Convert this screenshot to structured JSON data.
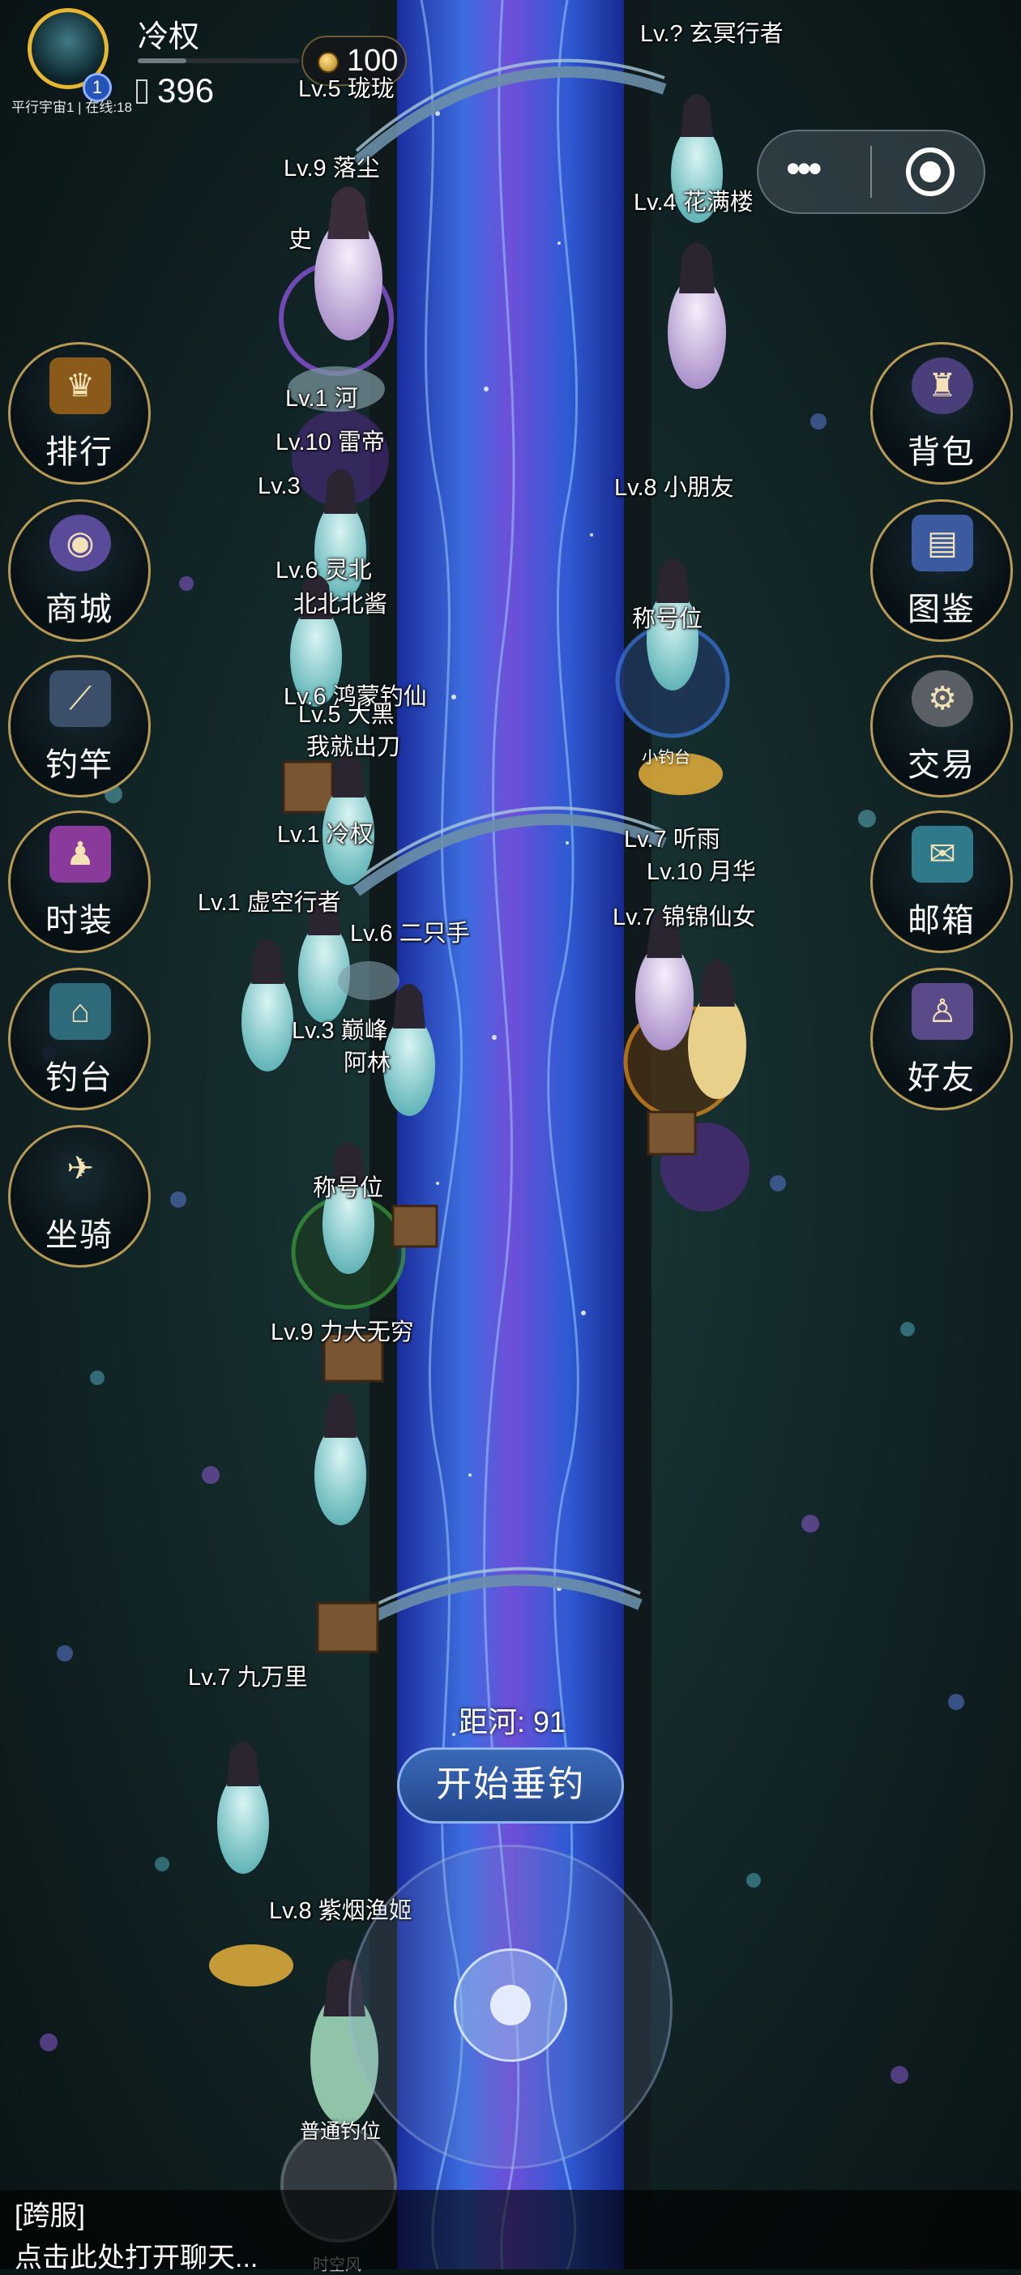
{
  "hud": {
    "player_name": "冷权",
    "level": "1",
    "server_info": "平行宇宙1 | 在线:18",
    "gems": "396",
    "coins": "100"
  },
  "menu_left": [
    {
      "label": "排行",
      "icon": "trophy-icon"
    },
    {
      "label": "商城",
      "icon": "shop-icon"
    },
    {
      "label": "钓竿",
      "icon": "fishing-rod-icon"
    },
    {
      "label": "时装",
      "icon": "costume-icon"
    },
    {
      "label": "钓台",
      "icon": "pavilion-icon"
    },
    {
      "label": "坐骑",
      "icon": "mount-icon"
    }
  ],
  "menu_right": [
    {
      "label": "背包",
      "icon": "backpack-icon"
    },
    {
      "label": "图鉴",
      "icon": "book-icon"
    },
    {
      "label": "交易",
      "icon": "trade-icon"
    },
    {
      "label": "邮箱",
      "icon": "mailbox-icon"
    },
    {
      "label": "好友",
      "icon": "friends-icon"
    }
  ],
  "players": [
    "Lv.5 珑珑",
    "Lv.? 玄冥行者",
    "Lv.9 落尘",
    "Lv.4 花满楼",
    "史",
    "Lv.1 河",
    "Lv.10 雷帝",
    "Lv.3",
    "Lv.8 小朋友",
    "Lv.6 灵北",
    "北北北酱",
    "称号位",
    "Lv.6 鸿蒙钓仙",
    "Lv.5 大黑",
    "我就出刀",
    "Lv.1 冷权",
    "Lv.7 听雨",
    "Lv.10 月华",
    "Lv.1 虚空行者",
    "Lv.6 二只手",
    "Lv.7 锦锦仙女",
    "Lv.3 巅峰",
    "阿林",
    "称号位",
    "Lv.9 力大无穷",
    "Lv.7 九万里",
    "Lv.8 紫烟渔姬"
  ],
  "spots": {
    "normal": "普通钓位",
    "current": "小钓台",
    "bottom": "时空风"
  },
  "controls": {
    "distance": "距河: 91",
    "start_button": "开始垂钓"
  },
  "chat": {
    "channel": "[跨服]",
    "hint": "点击此处打开聊天..."
  }
}
